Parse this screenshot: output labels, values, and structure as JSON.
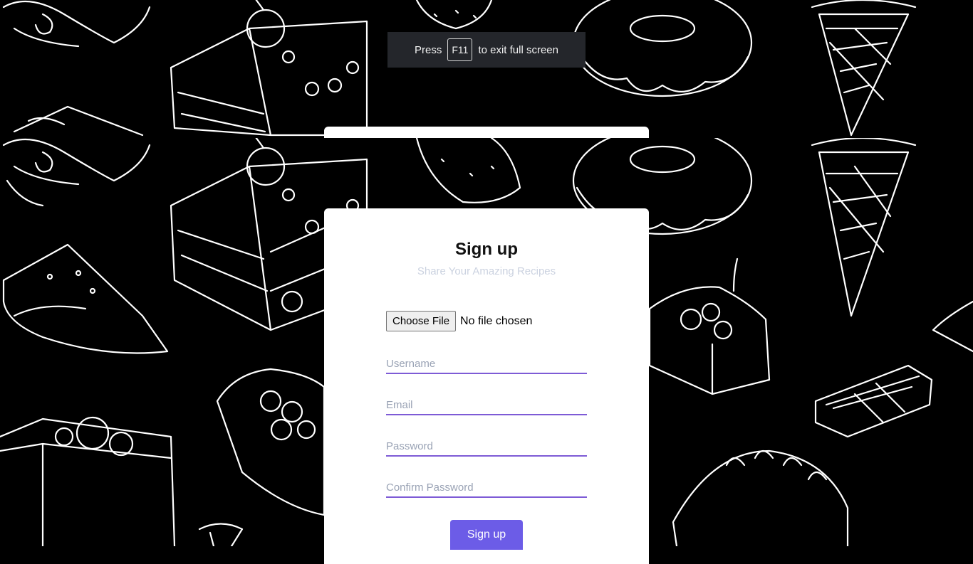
{
  "fullscreen_notice": {
    "prefix": "Press",
    "key": "F11",
    "suffix": "to exit full screen"
  },
  "form": {
    "title": "Sign up",
    "subtitle": "Share Your Amazing Recipes",
    "file_button_label": "Choose File",
    "file_status": "No file chosen",
    "username_placeholder": "Username",
    "email_placeholder": "Email",
    "password_placeholder": "Password",
    "confirm_password_placeholder": "Confirm Password",
    "submit_label": "Sign up"
  },
  "colors": {
    "background": "#000000",
    "card": "#ffffff",
    "accent": "#6c5ce7",
    "field_underline": "#7e5bd6",
    "subtitle": "#cbd2e0"
  },
  "background_art": "hand-drawn white dessert sketches on black"
}
